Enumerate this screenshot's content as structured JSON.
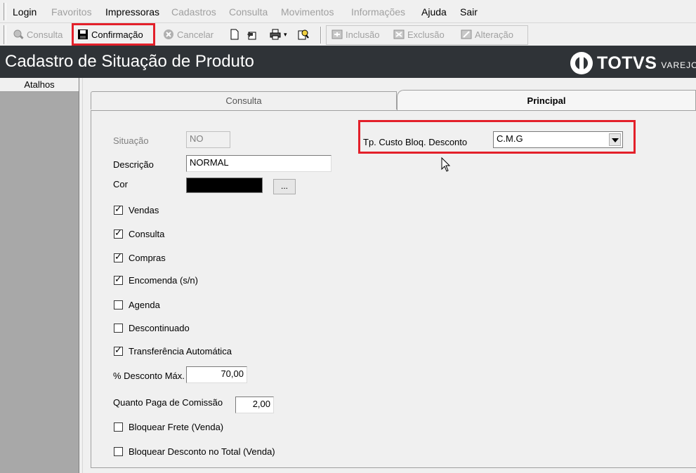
{
  "menu": {
    "login": "Login",
    "favoritos": "Favoritos",
    "impressoras": "Impressoras",
    "cadastros": "Cadastros",
    "consulta": "Consulta",
    "movimentos": "Movimentos",
    "informacoes": "Informações",
    "ajuda": "Ajuda",
    "sair": "Sair"
  },
  "toolbar": {
    "consulta": "Consulta",
    "confirmacao": "Confirmação",
    "cancelar": "Cancelar",
    "inclusao": "Inclusão",
    "exclusao": "Exclusão",
    "alteracao": "Alteração"
  },
  "title": "Cadastro de Situação de Produto",
  "logo": {
    "brand": "TOTVS",
    "sub": "VAREJO"
  },
  "sidebar": {
    "header": "Atalhos"
  },
  "tabs": {
    "consulta": "Consulta",
    "principal": "Principal"
  },
  "form": {
    "situacao_label": "Situação",
    "situacao_value": "NO",
    "descricao_label": "Descrição",
    "descricao_value": "NORMAL",
    "cor_label": "Cor",
    "cor_button": "...",
    "cor_value": "#000000",
    "tp_custo_label": "Tp. Custo Bloq. Desconto",
    "tp_custo_value": "C.M.G",
    "checkboxes": [
      {
        "label": "Vendas",
        "checked": true
      },
      {
        "label": "Consulta",
        "checked": true
      },
      {
        "label": "Compras",
        "checked": true
      },
      {
        "label": "Encomenda (s/n)",
        "checked": true
      },
      {
        "label": "Agenda",
        "checked": false
      },
      {
        "label": "Descontinuado",
        "checked": false
      },
      {
        "label": "Transferência Automática",
        "checked": true
      }
    ],
    "desconto_label": "% Desconto Máx.",
    "desconto_value": "70,00",
    "comissao_label": "Quanto Paga de Comissão",
    "comissao_value": "2,00",
    "bloq_frete_label": "Bloquear Frete (Venda)",
    "bloq_frete_checked": false,
    "bloq_desc_label": "Bloquear Desconto no Total (Venda)",
    "bloq_desc_checked": false
  },
  "colors": {
    "highlight": "#e3202a",
    "titlebar": "#2f3337",
    "sidebar": "#a8a8a8"
  }
}
